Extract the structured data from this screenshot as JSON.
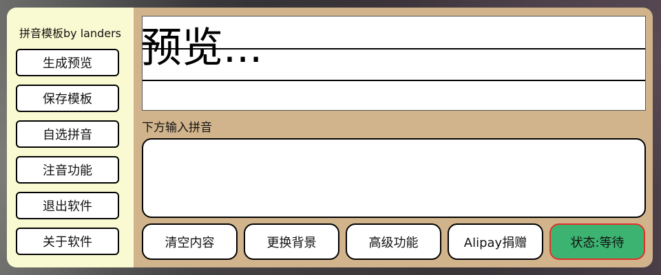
{
  "app": {
    "title": "拼音模板by landers"
  },
  "sidebar": {
    "buttons": [
      {
        "label": "生成预览"
      },
      {
        "label": "保存模板"
      },
      {
        "label": "自选拼音"
      },
      {
        "label": "注音功能"
      },
      {
        "label": "退出软件"
      },
      {
        "label": "关于软件"
      }
    ]
  },
  "preview": {
    "text": "预览..."
  },
  "input": {
    "label": "下方输入拼音",
    "value": ""
  },
  "actions": [
    {
      "label": "清空内容"
    },
    {
      "label": "更换背景"
    },
    {
      "label": "高级功能"
    },
    {
      "label": "Alipay捐赠"
    }
  ],
  "status": {
    "label": "状态:等待",
    "color": "#3cb371",
    "border": "#e0302a"
  },
  "colors": {
    "sidebar_bg": "#fafad2",
    "panel_bg": "#d2b48c"
  }
}
